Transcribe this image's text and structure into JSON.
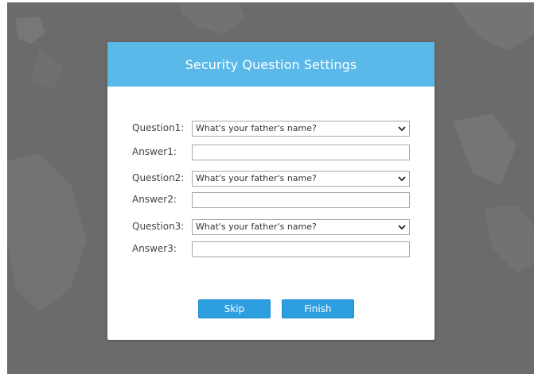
{
  "dialog": {
    "title": "Security Question Settings",
    "questions": [
      {
        "question_label": "Question1:",
        "question_value": "What's your father's name?",
        "answer_label": "Answer1:",
        "answer_value": ""
      },
      {
        "question_label": "Question2:",
        "question_value": "What's your father's name?",
        "answer_label": "Answer2:",
        "answer_value": ""
      },
      {
        "question_label": "Question3:",
        "question_value": "What's your father's name?",
        "answer_label": "Answer3:",
        "answer_value": ""
      }
    ],
    "skip_label": "Skip",
    "finish_label": "Finish"
  },
  "colors": {
    "header": "#5ab9e9",
    "button": "#2d9ee0",
    "backdrop": "#6b6b6b"
  },
  "icons": {
    "dropdown": "chevron-down-icon"
  }
}
